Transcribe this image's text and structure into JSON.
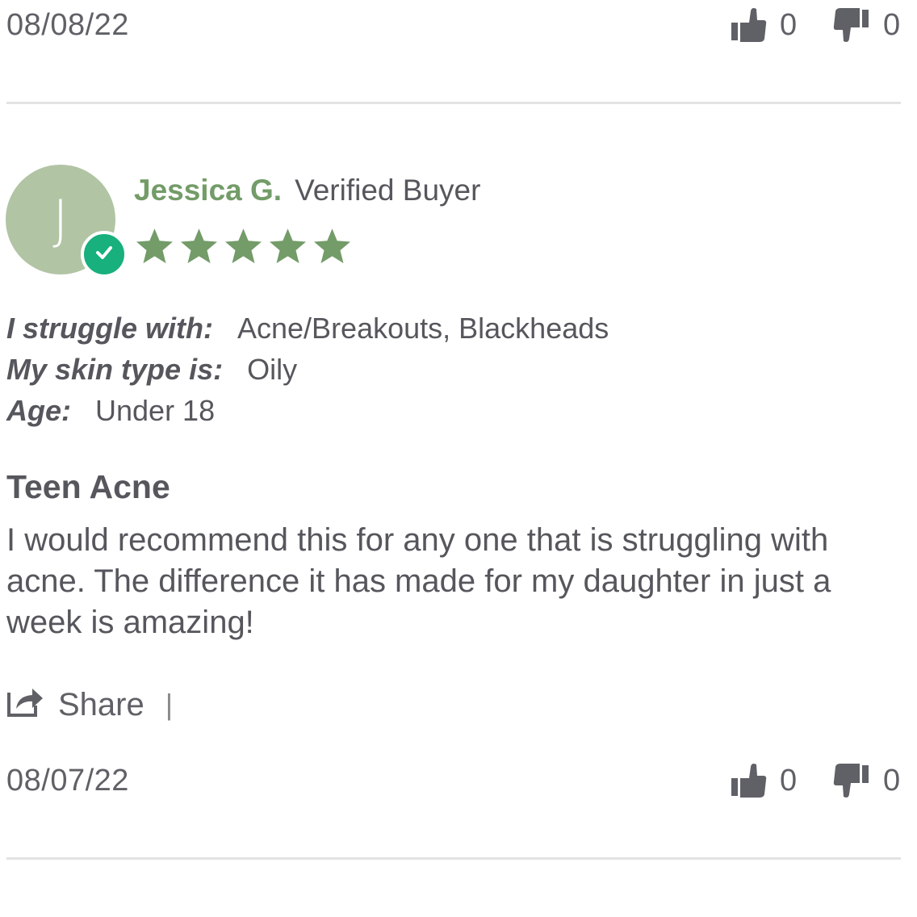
{
  "colors": {
    "name_green": "#739c68",
    "star_green": "#739c68",
    "avatar_bg": "#b1c4a4",
    "verified_badge": "#18b07d",
    "text_gray": "#55575c",
    "divider": "#e3e3e3"
  },
  "previous_review_footer": {
    "date": "08/08/22",
    "thumbs_up": {
      "icon": "thumbs-up-icon",
      "count": "0"
    },
    "thumbs_down": {
      "icon": "thumbs-down-icon",
      "count": "0"
    }
  },
  "review": {
    "avatar_initial": "J",
    "verified_badge_icon": "check-icon",
    "reviewer_name": "Jessica G.",
    "verified_label": "Verified Buyer",
    "rating": 5,
    "rating_max": 5,
    "attributes": [
      {
        "label": "I struggle with:",
        "value": "Acne/Breakouts, Blackheads"
      },
      {
        "label": "My skin type is:",
        "value": "Oily"
      },
      {
        "label": "Age:",
        "value": "Under 18"
      }
    ],
    "title": "Teen Acne",
    "body": "I would recommend this for any one that is struggling with acne. The difference it has made for my daughter in just a week is amazing!",
    "share": {
      "icon": "share-icon",
      "label": "Share",
      "separator": "|"
    },
    "date": "08/07/22",
    "thumbs_up": {
      "icon": "thumbs-up-icon",
      "count": "0"
    },
    "thumbs_down": {
      "icon": "thumbs-down-icon",
      "count": "0"
    }
  }
}
